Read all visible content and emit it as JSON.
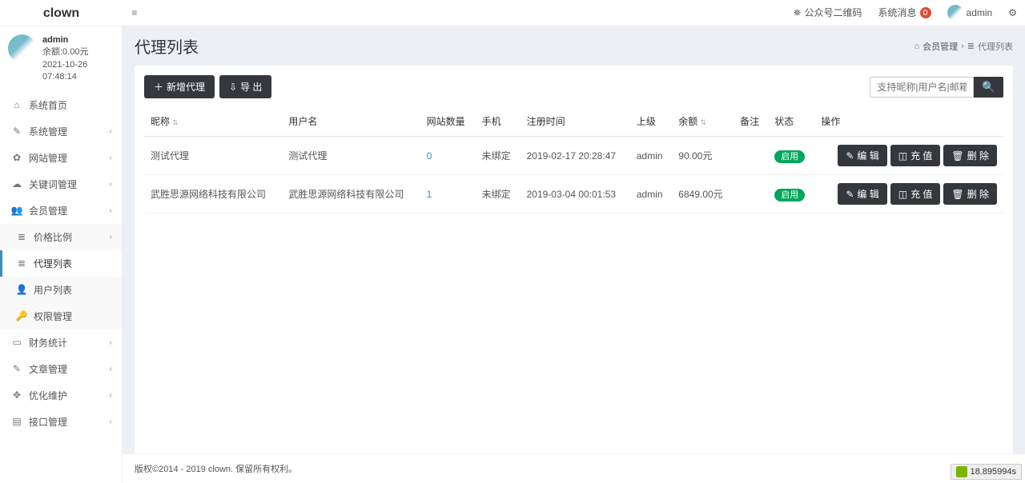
{
  "brand": "clown",
  "header": {
    "qr_label": "公众号二维码",
    "msg_label": "系统消息",
    "msg_badge": "0",
    "username": "admin"
  },
  "user": {
    "name": "admin",
    "balance": "余额:0.00元",
    "time": "2021-10-26 07:48:14"
  },
  "menu": [
    {
      "icon": "⌂",
      "label": "系统首页"
    },
    {
      "icon": "✎",
      "label": "系统管理",
      "chev": true
    },
    {
      "icon": "✿",
      "label": "网站管理",
      "chev": true
    },
    {
      "icon": "☁",
      "label": "关键词管理",
      "chev": true
    },
    {
      "icon": "👥",
      "label": "会员管理",
      "chev": true,
      "expanded": true,
      "children": [
        {
          "icon": "≣",
          "label": "价格比例",
          "chev": true
        },
        {
          "icon": "≣",
          "label": "代理列表",
          "active": true
        },
        {
          "icon": "👤",
          "label": "用户列表"
        },
        {
          "icon": "🔑",
          "label": "权限管理"
        }
      ]
    },
    {
      "icon": "▭",
      "label": "财务统计",
      "chev": true
    },
    {
      "icon": "✎",
      "label": "文章管理",
      "chev": true
    },
    {
      "icon": "✥",
      "label": "优化维护",
      "chev": true
    },
    {
      "icon": "▤",
      "label": "接口管理",
      "chev": true
    }
  ],
  "page": {
    "title": "代理列表",
    "breadcrumb": {
      "l1": "会员管理",
      "l2": "代理列表"
    },
    "add_label": "新增代理",
    "export_label": "导 出",
    "search_placeholder": "支持昵称|用户名|邮箱|手机"
  },
  "table": {
    "headers": {
      "nickname": "昵称",
      "username": "用户名",
      "sites": "网站数量",
      "phone": "手机",
      "regtime": "注册时间",
      "superior": "上级",
      "balance": "余额",
      "remark": "备注",
      "status": "状态",
      "action": "操作"
    },
    "rows": [
      {
        "nickname": "测试代理",
        "username": "测试代理",
        "sites": "0",
        "phone": "未绑定",
        "regtime": "2019-02-17 20:28:47",
        "superior": "admin",
        "balance": "90.00元",
        "remark": "",
        "status": "启用"
      },
      {
        "nickname": "武胜思源网络科技有限公司",
        "username": "武胜思源网络科技有限公司",
        "sites": "1",
        "phone": "未绑定",
        "regtime": "2019-03-04 00:01:53",
        "superior": "admin",
        "balance": "6849.00元",
        "remark": "",
        "status": "启用"
      }
    ],
    "actions": {
      "edit": "编 辑",
      "recharge": "充 值",
      "delete": "删 除"
    }
  },
  "footer": "版权©2014 - 2019 clown. 保留所有权利。",
  "perf": "18.895994s"
}
